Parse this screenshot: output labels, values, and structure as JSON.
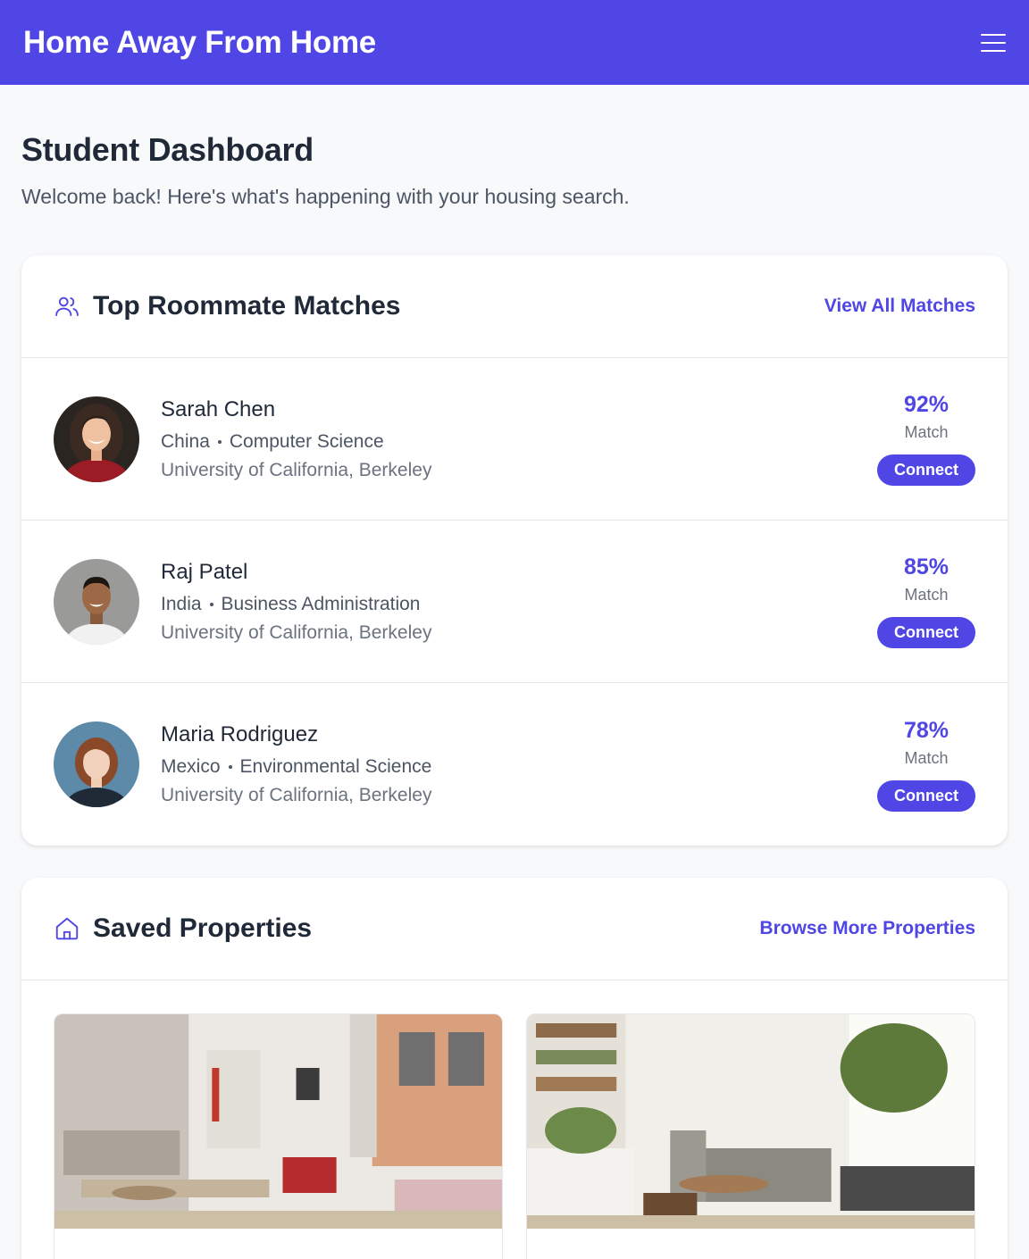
{
  "header": {
    "brand": "Home Away From Home",
    "menu_icon": "hamburger-menu-icon"
  },
  "page": {
    "title": "Student Dashboard",
    "subtitle": "Welcome back! Here's what's happening with your housing search."
  },
  "matches": {
    "title": "Top Roommate Matches",
    "icon": "users-icon",
    "view_all": "View All Matches",
    "items": [
      {
        "name": "Sarah Chen",
        "country": "China",
        "major": "Computer Science",
        "university": "University of California, Berkeley",
        "percent": "92%",
        "percent_label": "Match",
        "button": "Connect"
      },
      {
        "name": "Raj Patel",
        "country": "India",
        "major": "Business Administration",
        "university": "University of California, Berkeley",
        "percent": "85%",
        "percent_label": "Match",
        "button": "Connect"
      },
      {
        "name": "Maria Rodriguez",
        "country": "Mexico",
        "major": "Environmental Science",
        "university": "University of California, Berkeley",
        "percent": "78%",
        "percent_label": "Match",
        "button": "Connect"
      }
    ]
  },
  "properties": {
    "title": "Saved Properties",
    "icon": "home-icon",
    "browse_more": "Browse More Properties"
  },
  "colors": {
    "accent": "#4f46e5",
    "background": "#f8f9fb"
  }
}
